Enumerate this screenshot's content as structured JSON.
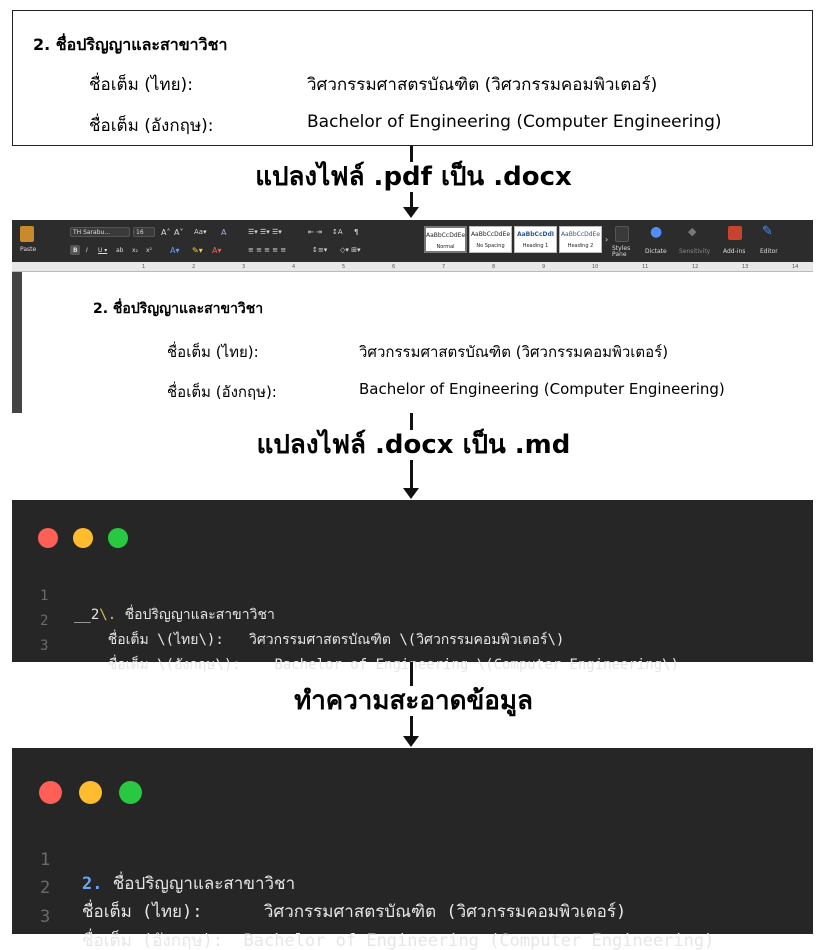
{
  "pdf_stage": {
    "heading": "2. ชื่อปริญญาและสาขาวิชา",
    "rows": [
      {
        "label": "ชื่อเต็ม (ไทย):",
        "value": "วิศวกรรมศาสตรบัณฑิต (วิศวกรรมคอมพิวเตอร์)"
      },
      {
        "label": "ชื่อเต็ม (อังกฤษ):",
        "value": "Bachelor of Engineering (Computer Engineering)"
      }
    ]
  },
  "steps": {
    "pdf_to_docx": "แปลงไฟล์ .pdf เป็น .docx",
    "docx_to_md": "แปลงไฟล์ .docx เป็น .md",
    "clean_data": "ทำความสะอาดข้อมูล"
  },
  "word_stage": {
    "ribbon": {
      "paste": "Paste",
      "font_name": "TH Sarabu...",
      "font_size": "16",
      "styles": [
        {
          "sample": "AaBbCcDdEe",
          "name": "Normal"
        },
        {
          "sample": "AaBbCcDdEe",
          "name": "No Spacing"
        },
        {
          "sample": "AaBbCcDdI",
          "name": "Heading 1"
        },
        {
          "sample": "AaBbCcDdEe",
          "name": "Heading 2"
        }
      ],
      "styles_pane": "Styles Pane",
      "dictate": "Dictate",
      "sensitivity": "Sensitivity",
      "add_ins": "Add-ins",
      "editor": "Editor"
    },
    "ruler_ticks": [
      "1",
      "2",
      "3",
      "4",
      "5",
      "6",
      "7",
      "8",
      "9",
      "10",
      "11",
      "12",
      "13",
      "14"
    ],
    "heading": "2. ชื่อปริญญาและสาขาวิชา",
    "rows": [
      {
        "label": "ชื่อเต็ม (ไทย):",
        "value": "วิศวกรรมศาสตรบัณฑิต (วิศวกรรมคอมพิวเตอร์)"
      },
      {
        "label": "ชื่อเต็ม (อังกฤษ):",
        "value": "Bachelor of Engineering (Computer Engineering)"
      }
    ]
  },
  "md_raw": {
    "lines": [
      {
        "num": "1",
        "prefix": "__2",
        "esc": "\\.",
        "rest": " ชื่อปริญญาและสาขาวิชา"
      },
      {
        "num": "2",
        "text": "    ชื่อเต็ม \\(ไทย\\):   วิศวกรรมศาสตรบัณฑิต \\(วิศวกรรมคอมพิวเตอร์\\)"
      },
      {
        "num": "3",
        "text": "    ชื่อเต็ม \\(อังกฤษ\\):    Bachelor of Engineering \\(Computer Engineering\\)"
      }
    ]
  },
  "md_clean": {
    "lines": [
      {
        "num": "1",
        "prefix": "2.",
        "rest": " ชื่อปริญญาและสาขาวิชา"
      },
      {
        "num": "2",
        "text": "ชื่อเต็ม (ไทย):      วิศวกรรมศาสตรบัณฑิต (วิศวกรรมคอมพิวเตอร์)"
      },
      {
        "num": "3",
        "text": "ชื่อเต็ม (อังกฤษ):  Bachelor of Engineering (Computer Engineering)"
      }
    ]
  },
  "colors": {
    "window_bg": "#262626",
    "traffic_red": "#fe5f57",
    "traffic_yellow": "#febc2e",
    "traffic_green": "#28c840",
    "number_accent": "#6aa6f7",
    "escape_accent": "#e0b75c"
  }
}
